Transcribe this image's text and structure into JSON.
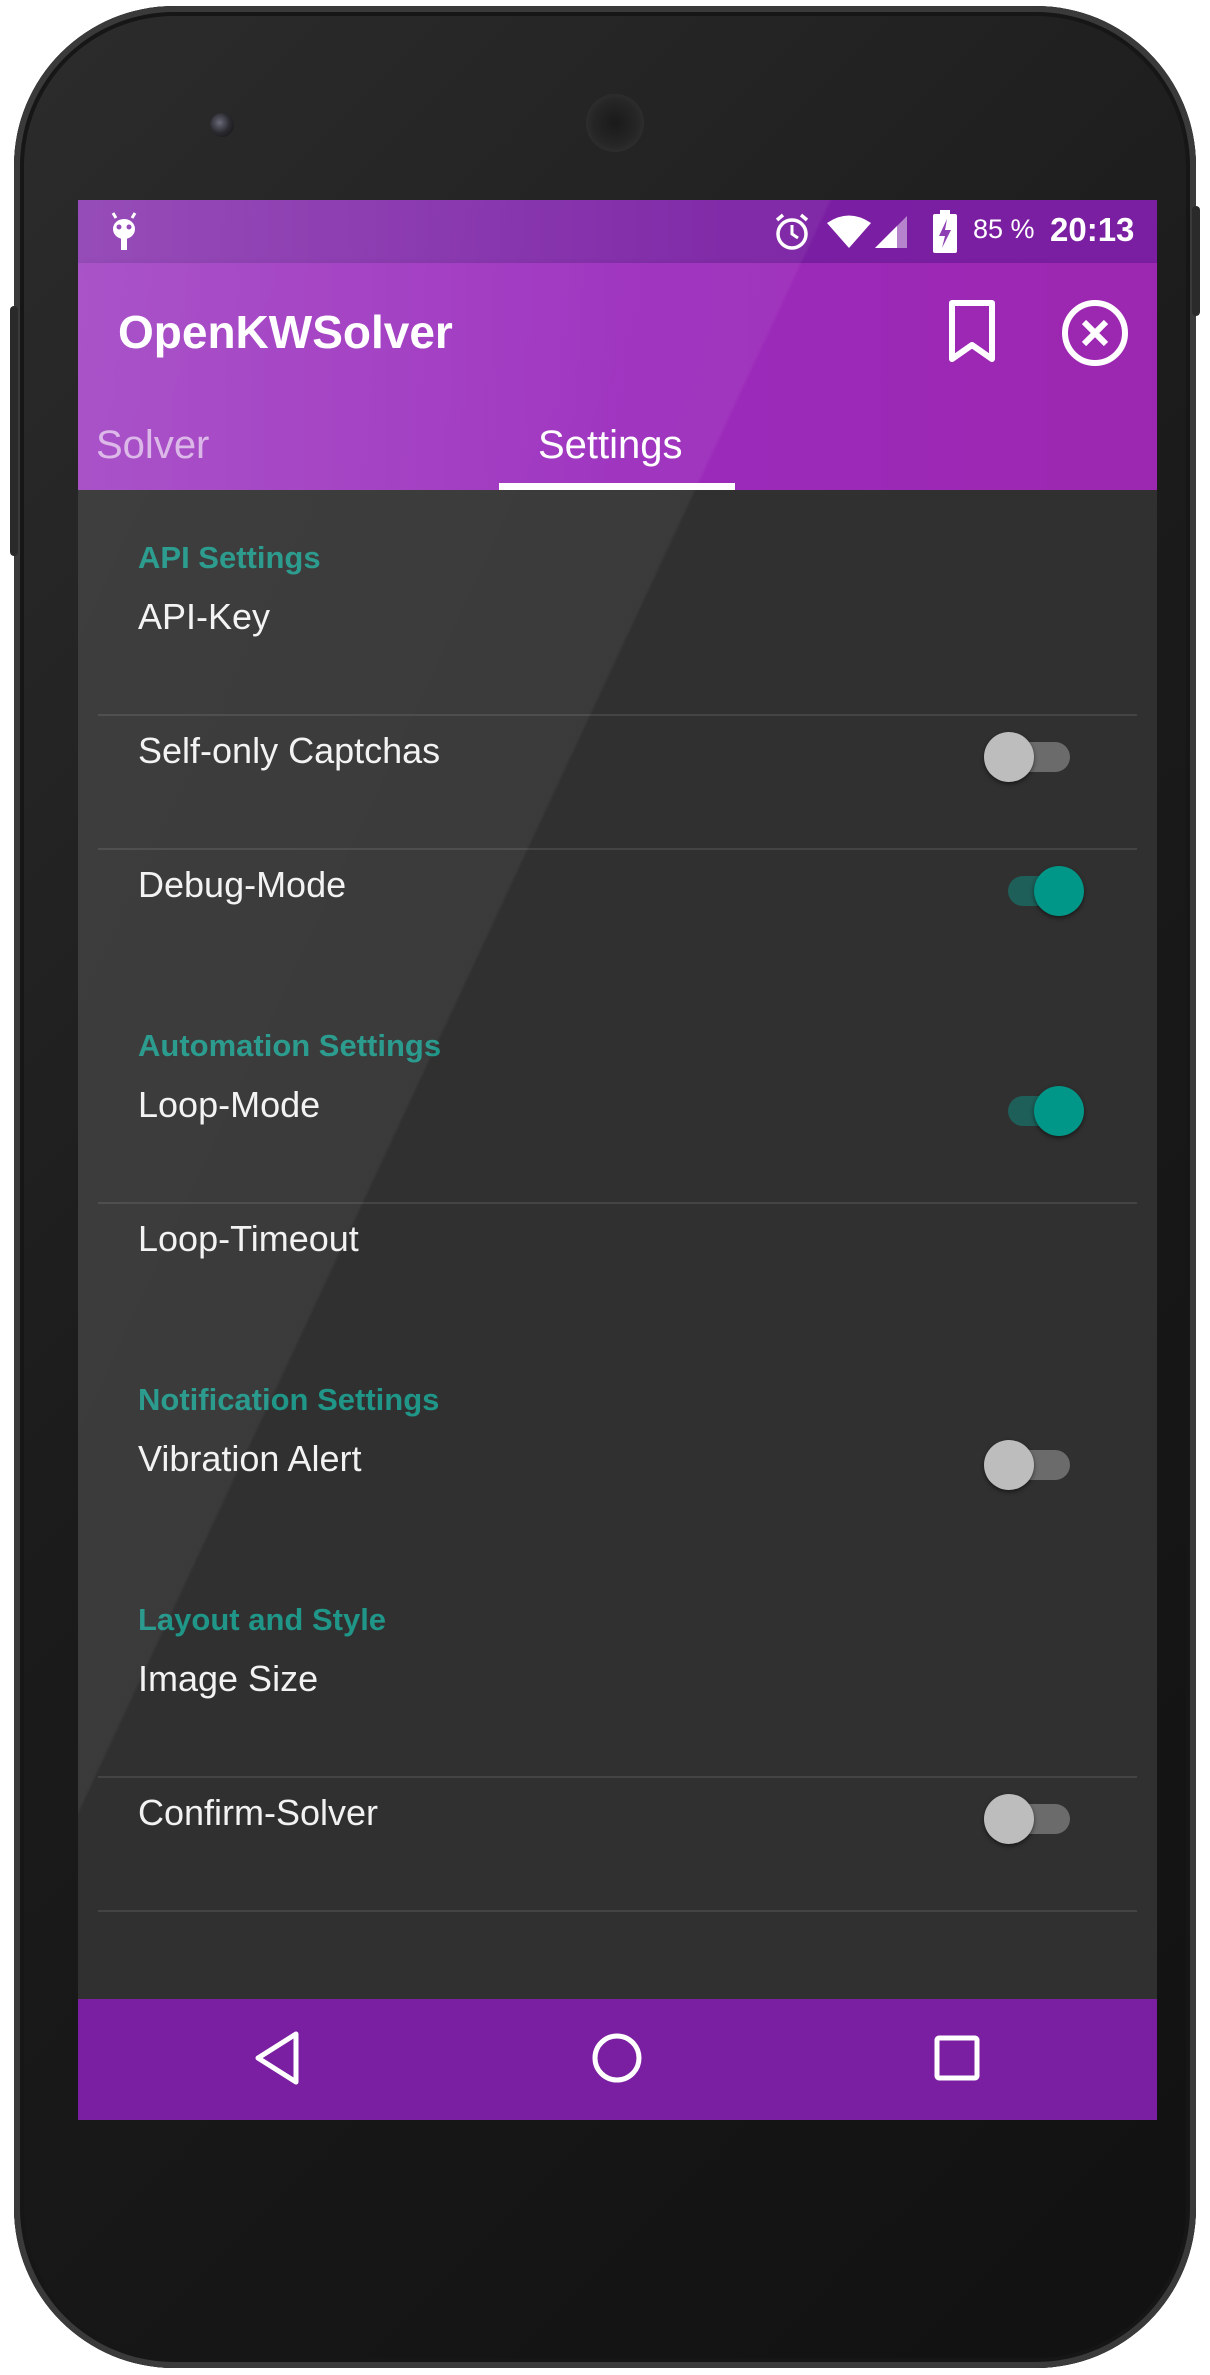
{
  "statusbar": {
    "battery_percent": "85 %",
    "time": "20:13"
  },
  "appbar": {
    "title": "OpenKWSolver"
  },
  "tabs": [
    {
      "label": "Solver",
      "selected": false
    },
    {
      "label": "Settings",
      "selected": true
    }
  ],
  "settings": {
    "api_header": "API Settings",
    "api_key": "API-Key",
    "self_only": {
      "label": "Self-only Captchas",
      "enabled": false
    },
    "debug": {
      "label": "Debug-Mode",
      "enabled": true
    },
    "automation_header": "Automation Settings",
    "loop_mode": {
      "label": "Loop-Mode",
      "enabled": true
    },
    "loop_timeout": "Loop-Timeout",
    "notification_header": "Notification Settings",
    "vibration": {
      "label": "Vibration Alert",
      "enabled": false
    },
    "layout_header": "Layout and Style",
    "image_size": "Image Size",
    "confirm_solver": {
      "label": "Confirm-Solver",
      "enabled": false
    }
  },
  "colors": {
    "primary": "#9c27b0",
    "primary_dark": "#7b1fa2",
    "accent": "#009688",
    "background": "#303030"
  }
}
